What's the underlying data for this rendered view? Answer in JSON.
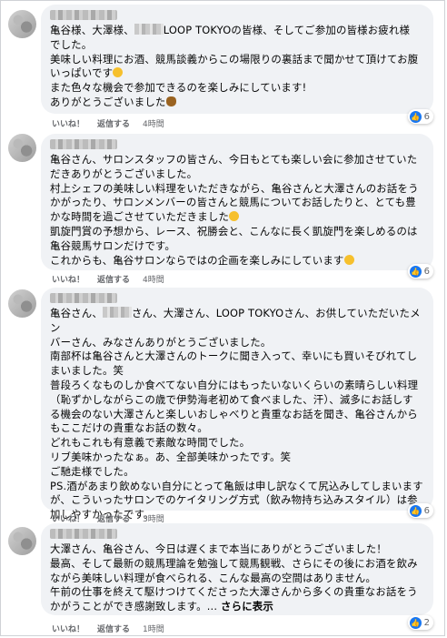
{
  "comments": [
    {
      "lines": [
        [
          "亀谷様、大澤様、",
          "REDACT",
          "LOOP TOKYOの皆様、そしてご参加の皆様お疲れ様"
        ],
        [
          "でした。"
        ],
        [
          "美味しい料理にお酒、競馬談義からこの場限りの裏話まで聞かせて頂けてお腹"
        ],
        [
          "いっぱいです",
          "EMOJI"
        ],
        [
          "また色々な機会で参加できるのを楽しみにしています!"
        ],
        [
          "ありがとうございました",
          "EMOJIPOO"
        ]
      ],
      "like_label": "いいね！",
      "reply_label": "返信する",
      "time": "4時間",
      "reaction_count": "6"
    },
    {
      "lines": [
        [
          "亀谷さん、サロンスタッフの皆さん、今日もとても楽しい会に参加させていた"
        ],
        [
          "だきありがとうございました。"
        ],
        [
          "村上シェフの美味しい料理をいただきながら、亀谷さんと大澤さんのお話をう"
        ],
        [
          "かがったり、サロンメンバーの皆さんと競馬についてお話したりと、とても豊"
        ],
        [
          "かな時間を過ごさせていただきました",
          "EMOJI"
        ],
        [
          "凱旋門賞の予想から、レース、祝勝会と、こんなに長く凱旋門を楽しめるのは"
        ],
        [
          "亀谷競馬サロンだけです。"
        ],
        [
          "これからも、亀谷サロンならではの企画を楽しみにしています",
          "EMOJI"
        ]
      ],
      "like_label": "いいね！",
      "reply_label": "返信する",
      "time": "4時間",
      "reaction_count": "6"
    },
    {
      "lines": [
        [
          "亀谷さん、",
          "REDACT",
          "さん、大澤さん、LOOP TOKYOさん、お供していただいたメン"
        ],
        [
          "バーさん、みなさんありがとうございました。"
        ],
        [
          "南部杯は亀谷さんと大澤さんのトークに聞き入って、幸いにも買いそびれてし"
        ],
        [
          "まいました。笑"
        ],
        [
          "普段ろくなものしか食べてない自分にはもったいないくらいの素晴らしい料理"
        ],
        [
          "（恥ずかしながらこの歳で伊勢海老初めて食べました、汗）、滅多にお話しす"
        ],
        [
          "る機会のない大澤さんと楽しいおしゃべりと貴重なお話を聞き、亀谷さんから"
        ],
        [
          "もここだけの貴重なお話の数々。"
        ],
        [
          "どれもこれも有意義で素敵な時間でした。"
        ],
        [
          "リブ美味かったなぁ。あ、全部美味かったです。笑"
        ],
        [
          "ご馳走様でした。"
        ],
        [
          "PS.酒があまり飲めない自分にとって亀飯は申し訳なくて尻込みしてしまいます"
        ],
        [
          "が、こういったサロンでのケイタリング方式（飲み物持ち込みスタイル）は参"
        ],
        [
          "加しやすかったです。"
        ]
      ],
      "like_label": "いいね！",
      "reply_label": "返信する",
      "time": "3時間",
      "reaction_count": "6"
    },
    {
      "lines": [
        [
          "大澤さん、亀谷さん、今日は遅くまで本当にありがとうございました！"
        ],
        [
          "最高、そして最新の競馬理論を勉強して競馬観戦、さらにその後にお酒を飲み"
        ],
        [
          "ながら美味しい料理が食べられる、こんな最高の空間はありません。"
        ],
        [
          "午前の仕事を終えて駆けつけてくださった大澤さんから多くの貴重なお話をう"
        ],
        [
          "かがうことができ感謝致します。... ",
          "MORE"
        ]
      ],
      "see_more": "さらに表示",
      "like_label": "いいね！",
      "reply_label": "返信する",
      "time": "1時間",
      "reaction_count": "2"
    }
  ],
  "colors": {
    "bubble": "#f0f2f5",
    "like_blue": "#1877f2",
    "meta_gray": "#65676b"
  },
  "icons": {
    "like": "thumbs-up-icon",
    "smile": "smiling-face-emoji",
    "poo": "poo-emoji"
  }
}
